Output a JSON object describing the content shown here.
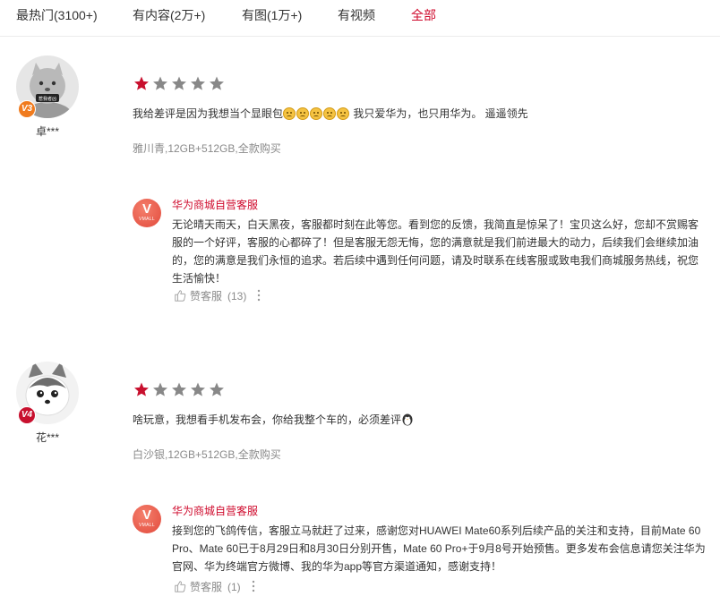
{
  "tabs": [
    {
      "label": "最热门(3100+)"
    },
    {
      "label": "有内容(2万+)"
    },
    {
      "label": "有图(1万+)"
    },
    {
      "label": "有视频"
    },
    {
      "label": "全部"
    }
  ],
  "active_tab": "全部",
  "colors": {
    "accent": "#cf0a2c",
    "star_filled": "#c8102e",
    "star_empty": "#888888",
    "muted": "#8a8a8a"
  },
  "reviews": [
    {
      "username": "卓***",
      "level": "V3",
      "level_color": "#f07b1e",
      "avatar_badge_text": "惹我者凶",
      "rating": 1,
      "content_before": "我给差评是因为我想当个显眼包",
      "emoji_icon": "worried-face-icon",
      "emoji_count": 5,
      "content_after": " 我只爱华为，也只用华为。 遥遥领先",
      "spec": "雅川青,12GB+512GB,全款购买",
      "reply": {
        "logo_text": "V",
        "logo_subtext": "VMALL",
        "name": "华为商城自营客服",
        "text": "无论晴天雨天，白天黑夜，客服都时刻在此等您。看到您的反馈，我简直是惊呆了！宝贝这么好，您却不赏赐客服的一个好评，客服的心都碎了！但是客服无怨无悔，您的满意就是我们前进最大的动力，后续我们会继续加油的，您的满意是我们永恒的追求。若后续中遇到任何问题，请及时联系在线客服或致电我们商城服务热线，祝您生活愉快！",
        "like_label": "赞客服",
        "like_count": "(13)"
      }
    },
    {
      "username": "花***",
      "level": "V4",
      "level_color": "#c8102e",
      "rating": 1,
      "content": "啥玩意，我想看手机发布会，你给我整个车的，必须差评",
      "content_emoji_icon": "penguin-icon",
      "spec": "白沙银,12GB+512GB,全款购买",
      "reply": {
        "logo_text": "V",
        "logo_subtext": "VMALL",
        "name": "华为商城自营客服",
        "text": "接到您的飞鸽传信，客服立马就赶了过来，感谢您对HUAWEI Mate60系列后续产品的关注和支持，目前Mate 60 Pro、Mate 60已于8月29日和8月30日分别开售，Mate 60 Pro+于9月8号开始预售。更多发布会信息请您关注华为官网、华为终端官方微博、我的华为app等官方渠道通知，感谢支持！",
        "like_label": "赞客服",
        "like_count": "(1)"
      }
    }
  ]
}
